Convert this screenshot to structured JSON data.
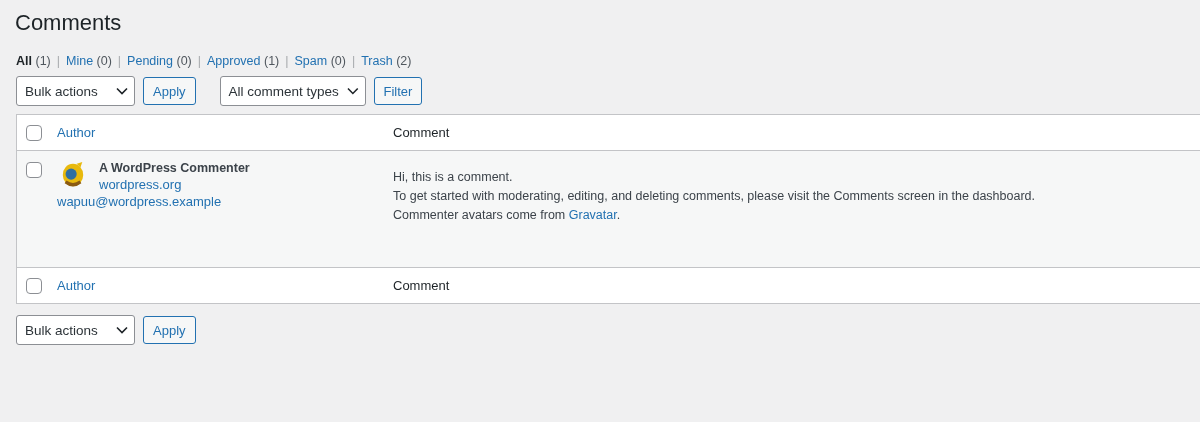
{
  "page_title": "Comments",
  "filters": [
    {
      "label": "All",
      "count": "(1)",
      "selected": true
    },
    {
      "separator": "|",
      "label": "Mine",
      "count": "(0)",
      "selected": false
    },
    {
      "separator": "|",
      "label": "Pending",
      "count": "(0)",
      "selected": false
    },
    {
      "separator": "|",
      "label": "Approved",
      "count": "(1)",
      "selected": false
    },
    {
      "separator": "|",
      "label": "Spam",
      "count": "(0)",
      "selected": false
    },
    {
      "separator": "|",
      "label": "Trash",
      "count": "(2)",
      "selected": false
    }
  ],
  "top_controls": {
    "bulk_actions": "Bulk actions",
    "apply": "Apply",
    "comment_type": "All comment types",
    "filter": "Filter"
  },
  "table": {
    "columns": {
      "author": "Author",
      "comment": "Comment"
    },
    "rows": [
      {
        "checked": false,
        "author_name": "A WordPress Commenter",
        "author_site": "wordpress.org",
        "author_email": "wapuu@wordpress.example",
        "comment_lines": [
          {
            "text": "Hi, this is a comment."
          },
          {
            "text": "To get started with moderating, editing, and deleting comments, please visit the Comments screen in the dashboard."
          },
          {
            "text": "Commenter avatars come from ",
            "link": "Gravatar",
            "after": "."
          }
        ]
      }
    ],
    "footer_columns": {
      "author": "Author",
      "comment": "Comment"
    },
    "header_checked": false,
    "footer_checked": false
  },
  "bottom_controls": {
    "bulk_actions": "Bulk actions",
    "apply": "Apply"
  }
}
